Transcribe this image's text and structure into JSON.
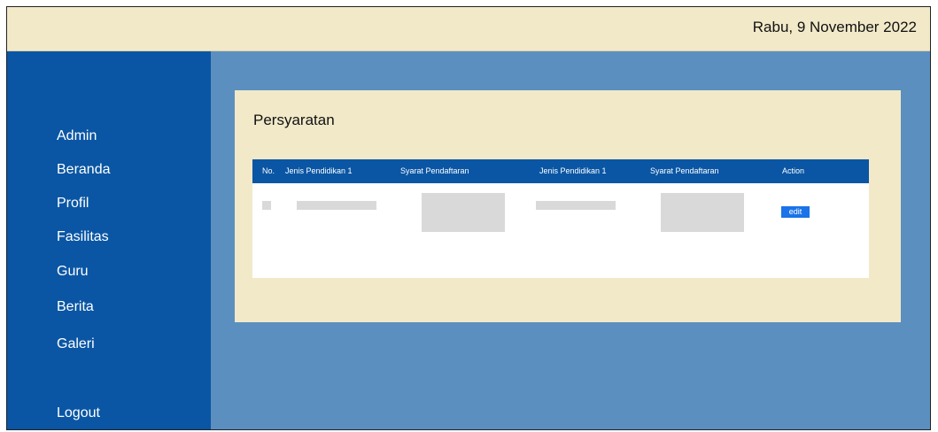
{
  "header": {
    "date": "Rabu, 9 November 2022"
  },
  "sidebar": {
    "items": [
      {
        "label": "Admin"
      },
      {
        "label": "Beranda"
      },
      {
        "label": "Profil"
      },
      {
        "label": "Fasilitas"
      },
      {
        "label": "Guru"
      },
      {
        "label": "Berita"
      },
      {
        "label": "Galeri"
      }
    ],
    "logout": "Logout"
  },
  "main": {
    "title": "Persyaratan",
    "table": {
      "columns": [
        "No.",
        "Jenis Pendidikan 1",
        "Syarat Pendaftaran",
        "Jenis Pendidikan 1",
        "Syarat Pendaftaran",
        "Action"
      ],
      "row_action": "edit"
    }
  },
  "colors": {
    "sidebar_bg": "#0a56a4",
    "topbar_bg": "#f2e9c9",
    "main_bg": "#5b8fbf",
    "card_bg": "#f2e9c9",
    "button": "#1a73e8"
  }
}
